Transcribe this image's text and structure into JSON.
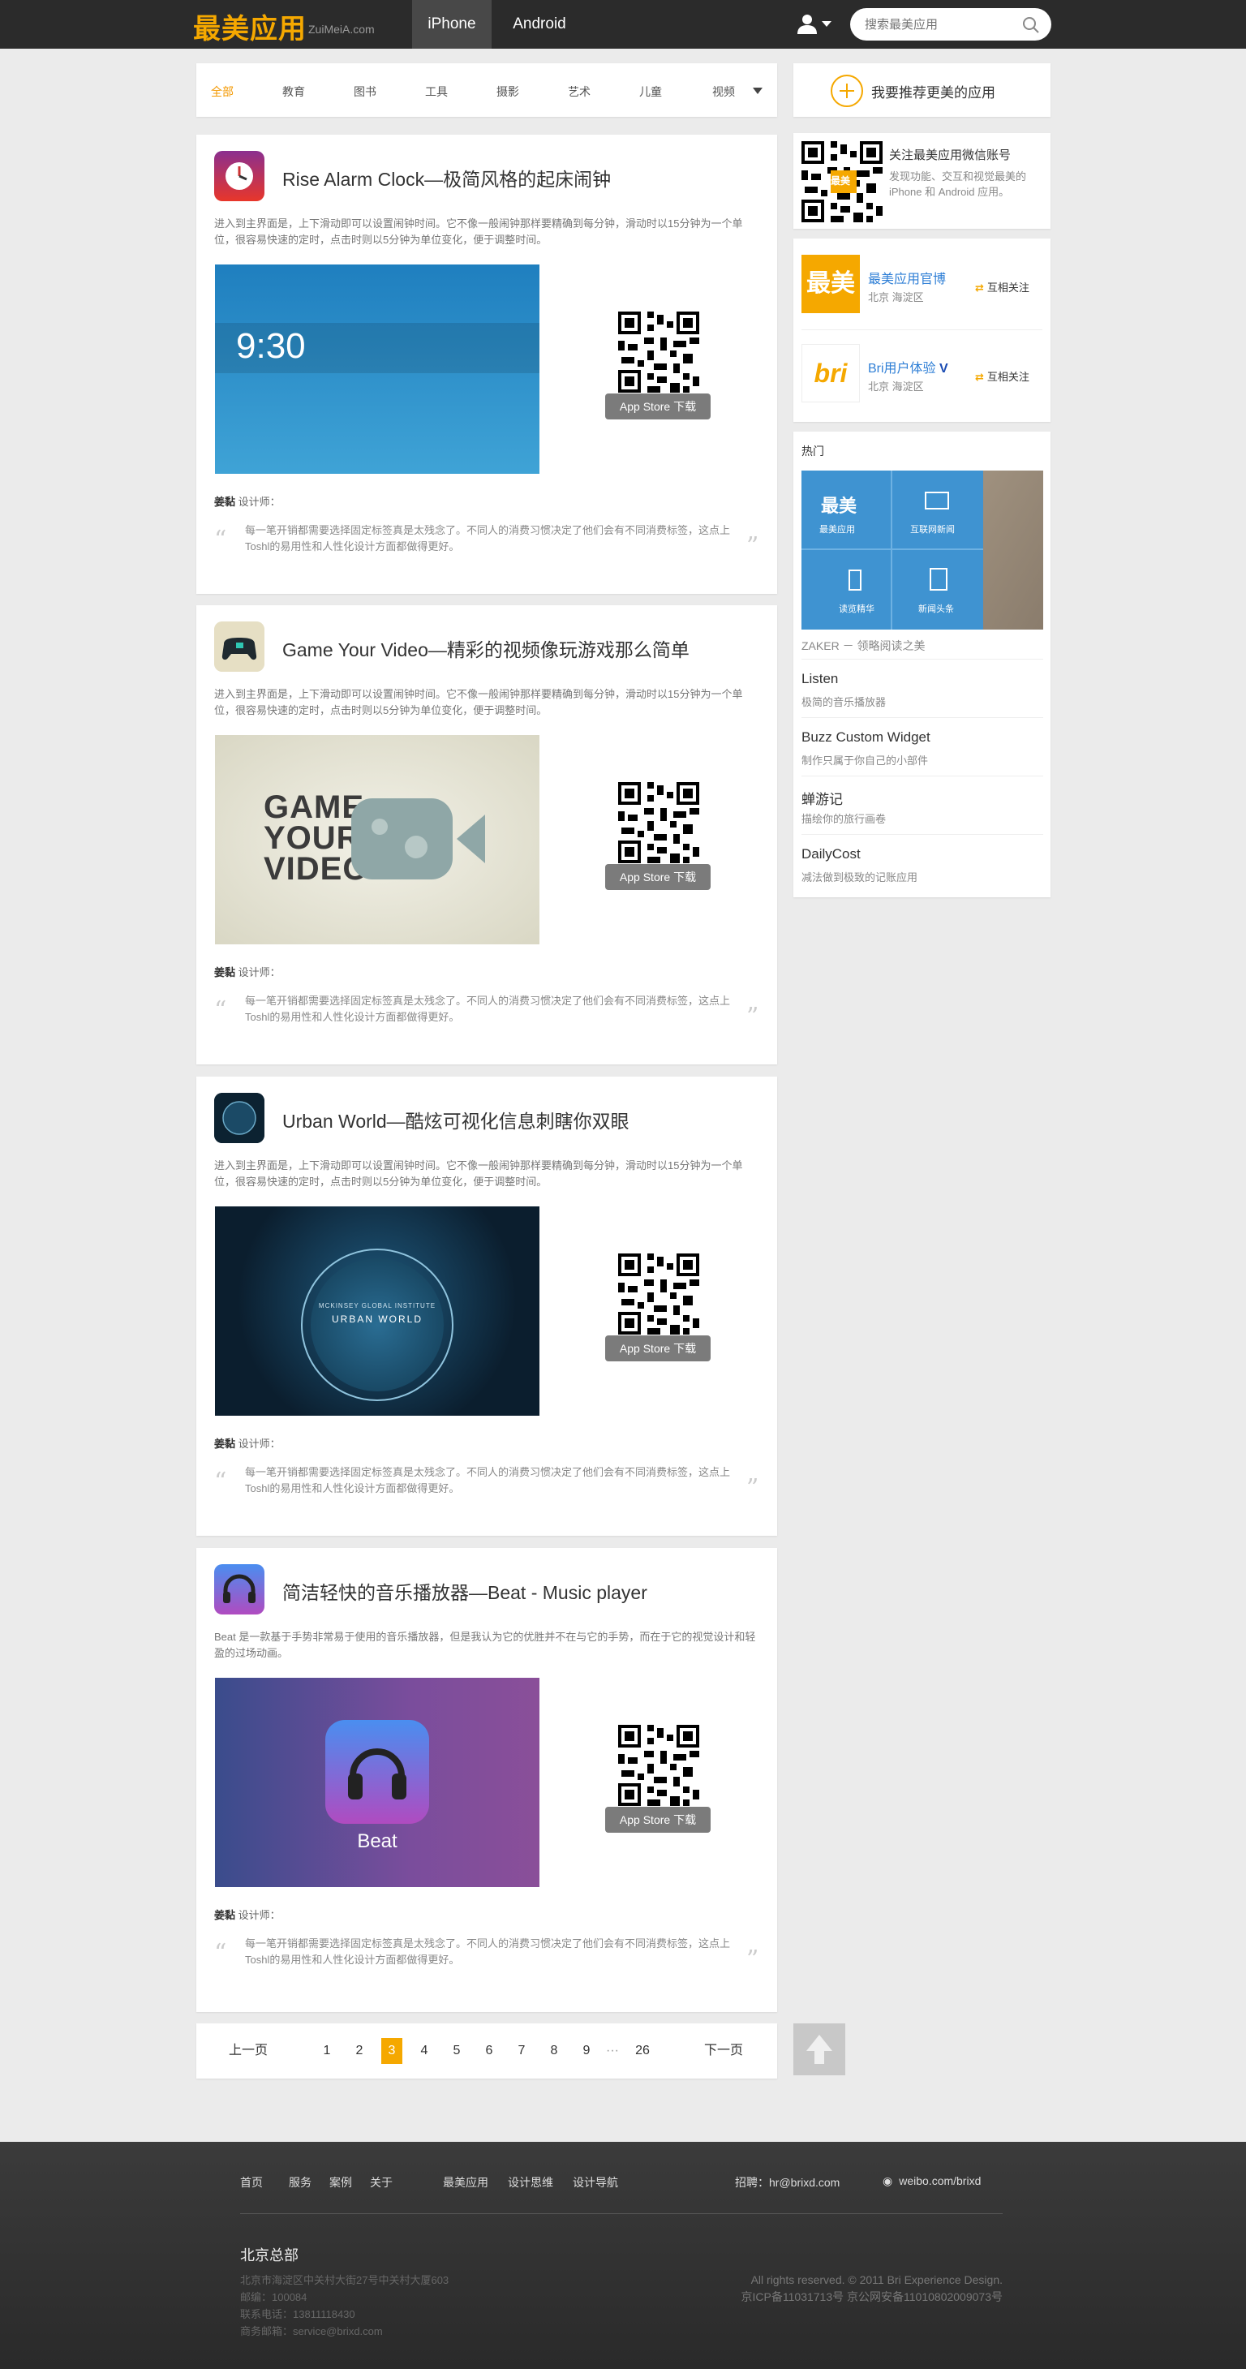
{
  "header": {
    "logo": "最美应用",
    "logo_sub": "ZuiMeiA.com",
    "tabs": [
      {
        "label": "iPhone",
        "active": true
      },
      {
        "label": "Android",
        "active": false
      }
    ],
    "search_placeholder": "搜索最美应用",
    "brand_color": "#f5a800"
  },
  "categories": {
    "items": [
      "全部",
      "教育",
      "图书",
      "工具",
      "摄影",
      "艺术",
      "儿童",
      "视频"
    ],
    "active": "全部"
  },
  "recommend_label": "我要推荐更美的应用",
  "apps": [
    {
      "title": "Rise Alarm Clock—极简风格的起床闹钟",
      "desc": "进入到主界面是，上下滑动即可以设置闹钟时间。它不像一般闹钟那样要精确到每分钟，滑动时以15分钟为一个单位，很容易快速的定时，点击时则以5分钟为单位变化，便于调整时间。",
      "screenshot_text": "9:30",
      "store_label": "App Store 下载",
      "designer_name": "姜黏",
      "designer_label": "设计师：",
      "quote": "每一笔开销都需要选择固定标签真是太残念了。不同人的消费习惯决定了他们会有不同消费标签，这点上Toshl的易用性和人性化设计方面都做得更好。"
    },
    {
      "title": "Game Your Video—精彩的视频像玩游戏那么简单",
      "desc": "进入到主界面是，上下滑动即可以设置闹钟时间。它不像一般闹钟那样要精确到每分钟，滑动时以15分钟为一个单位，很容易快速的定时，点击时则以5分钟为单位变化，便于调整时间。",
      "screenshot_text": "GAME YOUR VIDEO",
      "store_label": "App Store 下载",
      "designer_name": "姜黏",
      "designer_label": "设计师：",
      "quote": "每一笔开销都需要选择固定标签真是太残念了。不同人的消费习惯决定了他们会有不同消费标签，这点上Toshl的易用性和人性化设计方面都做得更好。"
    },
    {
      "title": "Urban World—酷炫可视化信息刺瞎你双眼",
      "desc": "进入到主界面是，上下滑动即可以设置闹钟时间。它不像一般闹钟那样要精确到每分钟，滑动时以15分钟为一个单位，很容易快速的定时，点击时则以5分钟为单位变化，便于调整时间。",
      "screenshot_text": "URBAN WORLD",
      "screenshot_sub": "MCKINSEY GLOBAL INSTITUTE",
      "store_label": "App Store 下载",
      "designer_name": "姜黏",
      "designer_label": "设计师：",
      "quote": "每一笔开销都需要选择固定标签真是太残念了。不同人的消费习惯决定了他们会有不同消费标签，这点上Toshl的易用性和人性化设计方面都做得更好。"
    },
    {
      "title": "简洁轻快的音乐播放器—Beat - Music player",
      "desc": "Beat 是一款基于手势非常易于使用的音乐播放器，但是我认为它的优胜并不在与它的手势，而在于它的视觉设计和轻盈的过场动画。",
      "screenshot_text": "Beat",
      "store_label": "App Store 下载",
      "designer_name": "姜黏",
      "designer_label": "设计师：",
      "quote": "每一笔开销都需要选择固定标签真是太残念了。不同人的消费习惯决定了他们会有不同消费标签，这点上Toshl的易用性和人性化设计方面都做得更好。"
    }
  ],
  "wechat": {
    "title": "关注最美应用微信账号",
    "desc": "发现功能、交互和视觉最美的 iPhone 和 Android 应用。",
    "badge": "最美"
  },
  "follows": [
    {
      "logo": "最美",
      "name": "最美应用官博",
      "loc": "北京 海淀区",
      "btn": "互相关注"
    },
    {
      "logo": "bri",
      "name": "Bri用户体验",
      "loc": "北京 海淀区",
      "btn": "互相关注"
    }
  ],
  "hot": {
    "heading": "热门",
    "tiles": [
      "最美应用",
      "互联网新闻",
      "读览精华",
      "新闻头条"
    ],
    "tile_logo": "最美",
    "caption": "ZAKER － 领略阅读之美",
    "items": [
      {
        "title": "Listen",
        "desc": "极简的音乐播放器"
      },
      {
        "title": "Buzz Custom Widget",
        "desc": "制作只属于你自己的小部件"
      },
      {
        "title": "蝉游记",
        "desc": "描绘你的旅行画卷"
      },
      {
        "title": "DailyCost",
        "desc": "减法做到极致的记账应用"
      }
    ]
  },
  "pager": {
    "prev": "上一页",
    "next": "下一页",
    "pages": [
      "1",
      "2",
      "3",
      "4",
      "5",
      "6",
      "7",
      "8",
      "9",
      "···",
      "26"
    ],
    "current": "3"
  },
  "footer": {
    "links": [
      "首页",
      "服务",
      "案例",
      "关于",
      "最美应用",
      "设计思维",
      "设计导航"
    ],
    "recruit_label": "招聘：",
    "recruit_email": "hr@brixd.com",
    "weibo": "weibo.com/brixd",
    "hq": "北京总部",
    "address_lines": [
      "北京市海淀区中关村大街27号中关村大厦603",
      "邮编：100084",
      "联系电话：13811118430",
      "商务邮箱：service@brixd.com"
    ],
    "copyright_lines": [
      "All rights reserved. © 2011 Bri Experience Design.",
      "京ICP备11031713号 京公网安备11010802009073号"
    ]
  }
}
